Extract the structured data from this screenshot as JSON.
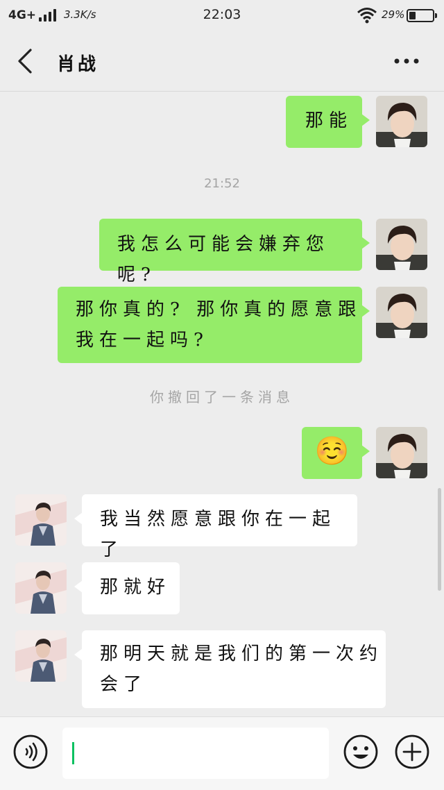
{
  "status_bar": {
    "network": "4G+",
    "speed": "3.3K/s",
    "time": "22:03",
    "battery_pct_text": "29%",
    "battery_level": 0.29
  },
  "header": {
    "title": "肖战",
    "back_icon": "chevron-left-icon",
    "more_icon": "more-dots-icon"
  },
  "messages": [
    {
      "from": "me",
      "text": "那能"
    },
    {
      "type": "timestamp",
      "text": "21:52"
    },
    {
      "from": "me",
      "text": "我怎么可能会嫌弃您呢?"
    },
    {
      "from": "me",
      "lines": [
        "那你真的? 那你真的愿意跟",
        "我在一起吗?"
      ]
    },
    {
      "type": "system",
      "text": "你撤回了一条消息"
    },
    {
      "from": "me",
      "text": "☺️",
      "emoji_name": "smiling-face-emoji"
    },
    {
      "from": "other",
      "text": "我当然愿意跟你在一起了"
    },
    {
      "from": "other",
      "text": "那就好"
    },
    {
      "from": "other",
      "lines": [
        "那明天就是我们的第一次约",
        "会了"
      ]
    }
  ],
  "input_bar": {
    "voice_icon": "voice-icon",
    "input_value": "",
    "emoji_icon": "emoji-icon",
    "plus_icon": "plus-icon"
  },
  "colors": {
    "background": "#ededed",
    "my_bubble": "#95ec69",
    "other_bubble": "#ffffff",
    "cursor": "#07c160",
    "system_text": "#a5a5a5"
  }
}
